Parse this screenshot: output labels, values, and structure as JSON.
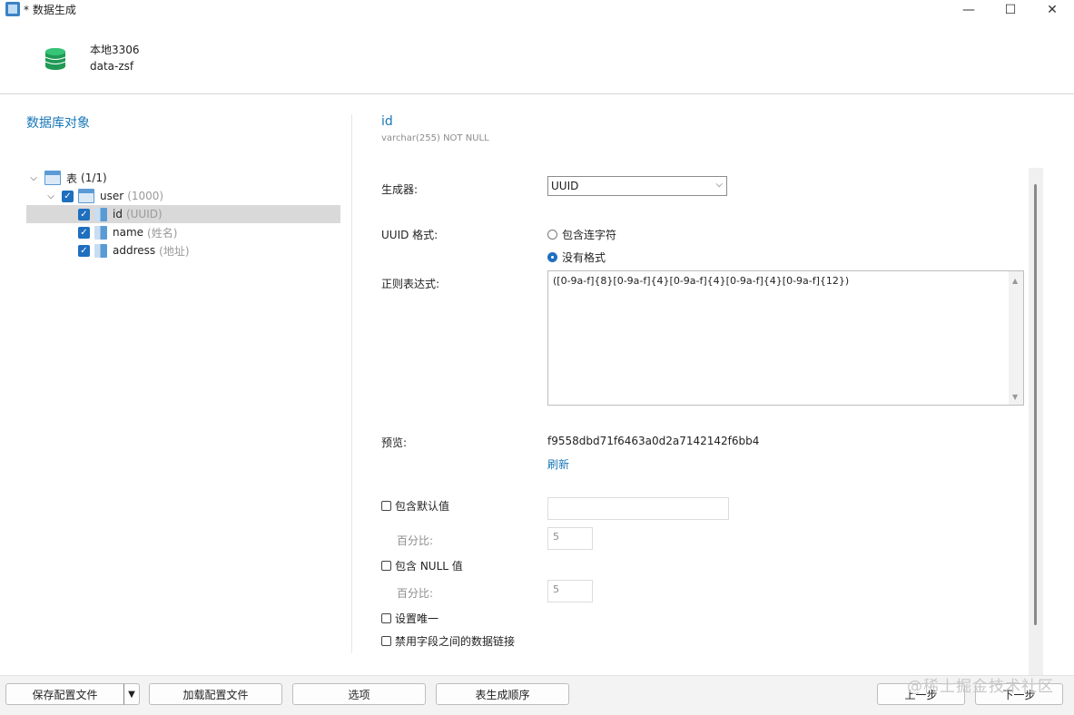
{
  "window": {
    "title": "* 数据生成",
    "controls": {
      "minimize": "—",
      "maximize": "☐",
      "close": "✕"
    }
  },
  "header": {
    "connection": "本地3306",
    "database": "data-zsf"
  },
  "left_pane": {
    "title": "数据库对象",
    "tree": {
      "root": {
        "label": "表",
        "count": "(1/1)"
      },
      "table": {
        "label": "user",
        "count": "(1000)"
      },
      "columns": [
        {
          "label": "id",
          "generator": "(UUID)"
        },
        {
          "label": "name",
          "generator": "(姓名)"
        },
        {
          "label": "address",
          "generator": "(地址)"
        }
      ]
    }
  },
  "field": {
    "name": "id",
    "type": "varchar(255) NOT NULL"
  },
  "form": {
    "generator_label": "生成器:",
    "generator_value": "UUID",
    "uuid_format_label": "UUID 格式:",
    "uuid_options": [
      "包含连字符",
      "没有格式"
    ],
    "uuid_selected": "没有格式",
    "regex_label": "正则表达式:",
    "regex_value": "([0-9a-f]{8}[0-9a-f]{4}[0-9a-f]{4}[0-9a-f]{4}[0-9a-f]{12})",
    "preview_label": "预览:",
    "preview_value": "f9558dbd71f6463a0d2a7142142f6bb4",
    "refresh_label": "刷新",
    "include_default_label": "包含默认值",
    "percent_label": "百分比:",
    "default_percent": "5",
    "include_null_label": "包含 NULL 值",
    "null_percent": "5",
    "unique_label": "设置唯一",
    "disable_link_label": "禁用字段之间的数据链接"
  },
  "buttons": {
    "save_config": "保存配置文件",
    "split_arrow": "▼",
    "load_config": "加载配置文件",
    "options": "选项",
    "table_order": "表生成顺序",
    "prev": "上一步",
    "next": "下一步"
  },
  "watermark": "@稀土掘金技术社区",
  "icons": {
    "expand": "chevron-down-icon",
    "check": "checkmark-icon"
  },
  "colors": {
    "accent": "#1877b8",
    "checkbox": "#1f6fbf",
    "selection": "#d9d9d9"
  }
}
